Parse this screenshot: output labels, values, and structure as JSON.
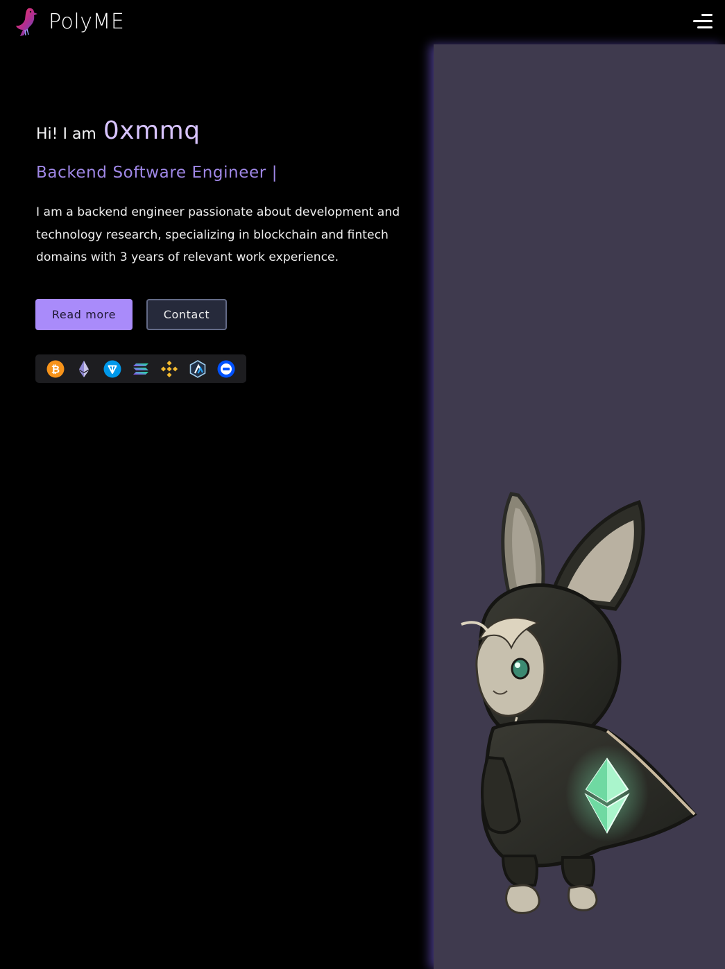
{
  "header": {
    "brand": "PolyME",
    "logo_icon": "bird-logo-icon",
    "menu_icon": "hamburger-menu-icon"
  },
  "hero": {
    "greeting_prefix": "Hi! I am",
    "name": "0xmmq",
    "role": "Backend Software Engineer |",
    "bio": "I am a backend engineer passionate about development and technology research, specializing in blockchain and fintech domains with 3 years of relevant work experience.",
    "buttons": {
      "read_more": "Read more",
      "contact": "Contact"
    }
  },
  "crypto_icons": [
    {
      "name": "bitcoin-icon",
      "color": "#f7931a"
    },
    {
      "name": "ethereum-icon",
      "color": "#c9c5e8"
    },
    {
      "name": "ton-icon",
      "color": "#0098ea"
    },
    {
      "name": "solana-icon",
      "color": "#9945ff"
    },
    {
      "name": "bnb-icon",
      "color": "#f3ba2f"
    },
    {
      "name": "arbitrum-icon",
      "color": "#28a0f0"
    },
    {
      "name": "doge-icon",
      "color": "#0052ff"
    }
  ],
  "illustration": {
    "name": "hooded-rabbit-ethereum-illustration",
    "panel_color": "#3f3a4e",
    "accent_color": "#7fe8b0"
  },
  "colors": {
    "background": "#000000",
    "accent_purple": "#a98bfa",
    "name_color": "#d8c4ff",
    "role_color": "#9f87e6"
  }
}
